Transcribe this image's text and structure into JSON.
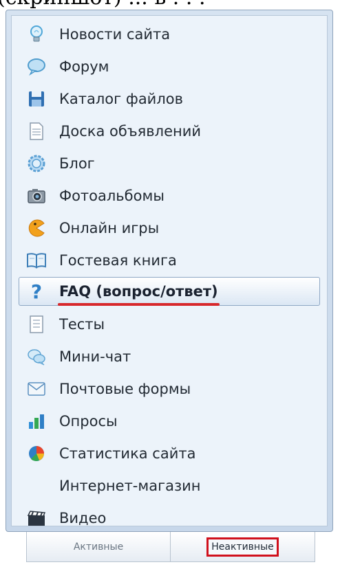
{
  "top_fragment_text": "(скриншот) ... в . . .",
  "menu": {
    "items": [
      {
        "label": "Новости сайта",
        "icon": "lightbulb-icon",
        "selected": false
      },
      {
        "label": "Форум",
        "icon": "speech-bubble-icon",
        "selected": false
      },
      {
        "label": "Каталог файлов",
        "icon": "floppy-disk-icon",
        "selected": false
      },
      {
        "label": "Доска объявлений",
        "icon": "document-icon",
        "selected": false
      },
      {
        "label": "Блог",
        "icon": "gear-icon",
        "selected": false
      },
      {
        "label": "Фотоальбомы",
        "icon": "camera-icon",
        "selected": false
      },
      {
        "label": "Онлайн игры",
        "icon": "pacman-icon",
        "selected": false
      },
      {
        "label": "Гостевая книга",
        "icon": "open-book-icon",
        "selected": false
      },
      {
        "label": "FAQ (вопрос/ответ)",
        "icon": "question-mark-icon",
        "selected": true
      },
      {
        "label": "Тесты",
        "icon": "checklist-icon",
        "selected": false
      },
      {
        "label": "Мини-чат",
        "icon": "chat-bubbles-icon",
        "selected": false
      },
      {
        "label": "Почтовые формы",
        "icon": "envelope-icon",
        "selected": false
      },
      {
        "label": "Опросы",
        "icon": "bar-chart-icon",
        "selected": false
      },
      {
        "label": "Статистика сайта",
        "icon": "pie-chart-icon",
        "selected": false
      },
      {
        "label": "Интернет-магазин",
        "icon": "",
        "selected": false
      },
      {
        "label": "Видео",
        "icon": "clapperboard-icon",
        "selected": false
      }
    ]
  },
  "tabs": {
    "active_label": "Активные",
    "inactive_label": "Неактивные"
  },
  "colors": {
    "highlight_underline": "#d7272b",
    "tab_box_outline": "#d0101c",
    "menu_background": "#ecf3fa"
  }
}
